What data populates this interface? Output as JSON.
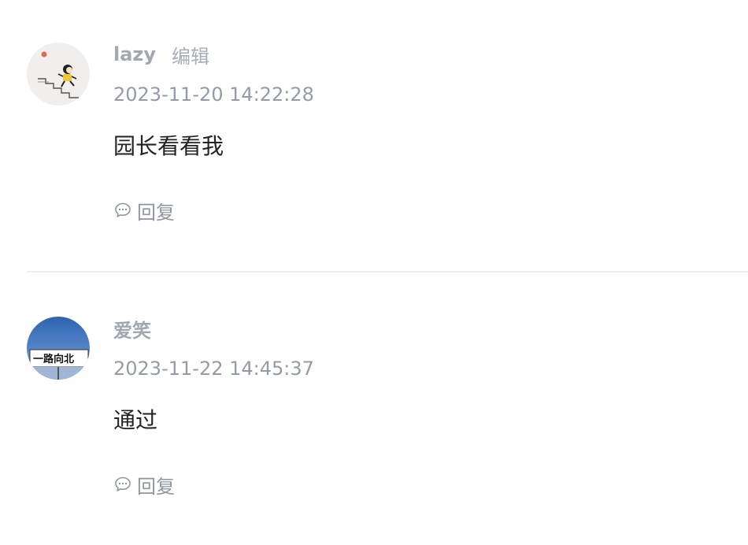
{
  "comments": [
    {
      "author": "lazy",
      "edit_label": "编辑",
      "timestamp": "2023-11-20 14:22:28",
      "content": "园长看看我",
      "reply_label": "回复",
      "avatar_icon": "cartoon-running-stairs-icon"
    },
    {
      "author": "爱笑",
      "timestamp": "2023-11-22 14:45:37",
      "content": "通过",
      "reply_label": "回复",
      "avatar_icon": "sky-sign-icon",
      "avatar_text": "一路向北"
    }
  ],
  "colors": {
    "name": "#a1a8b2",
    "meta": "#949ba6",
    "content": "#222222",
    "divider": "#ebedf0",
    "sky": "#3a6fb8"
  }
}
